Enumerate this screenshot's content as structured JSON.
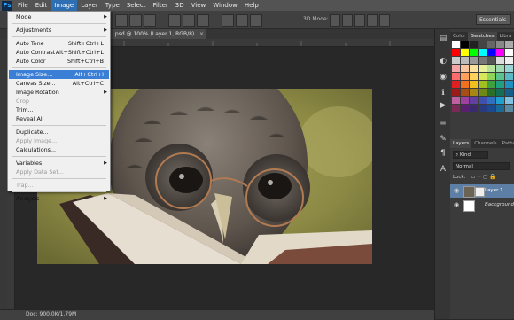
{
  "menubar": {
    "logo": "Ps",
    "items": [
      "File",
      "Edit",
      "Image",
      "Layer",
      "Type",
      "Select",
      "Filter",
      "3D",
      "View",
      "Window",
      "Help"
    ],
    "active_index": 2
  },
  "options_bar": {
    "mode_label": "3D Mode:",
    "workspace_label": "Essentials"
  },
  "document_tab": {
    "label": ".psd @ 100% (Layer 1, RGB/8)",
    "close": "×"
  },
  "status_bar": {
    "doc_info": "Doc: 900.0K/1.79M"
  },
  "image_menu": {
    "items": [
      {
        "label": "Mode",
        "shortcut": "",
        "submenu": true,
        "disabled": false
      },
      {
        "sep": true
      },
      {
        "label": "Adjustments",
        "shortcut": "",
        "submenu": true,
        "disabled": false
      },
      {
        "sep": true
      },
      {
        "label": "Auto Tone",
        "shortcut": "Shift+Ctrl+L",
        "disabled": false
      },
      {
        "label": "Auto Contrast",
        "shortcut": "Alt+Shift+Ctrl+L",
        "disabled": false
      },
      {
        "label": "Auto Color",
        "shortcut": "Shift+Ctrl+B",
        "disabled": false
      },
      {
        "sep": true
      },
      {
        "label": "Image Size...",
        "shortcut": "Alt+Ctrl+I",
        "disabled": false,
        "highlighted": true
      },
      {
        "label": "Canvas Size...",
        "shortcut": "Alt+Ctrl+C",
        "disabled": false
      },
      {
        "label": "Image Rotation",
        "shortcut": "",
        "submenu": true,
        "disabled": false
      },
      {
        "label": "Crop",
        "shortcut": "",
        "disabled": true
      },
      {
        "label": "Trim...",
        "shortcut": "",
        "disabled": false
      },
      {
        "label": "Reveal All",
        "shortcut": "",
        "disabled": false
      },
      {
        "sep": true
      },
      {
        "label": "Duplicate...",
        "shortcut": "",
        "disabled": false
      },
      {
        "label": "Apply Image...",
        "shortcut": "",
        "disabled": true
      },
      {
        "label": "Calculations...",
        "shortcut": "",
        "disabled": false
      },
      {
        "sep": true
      },
      {
        "label": "Variables",
        "shortcut": "",
        "submenu": true,
        "disabled": false
      },
      {
        "label": "Apply Data Set...",
        "shortcut": "",
        "disabled": true
      },
      {
        "sep": true
      },
      {
        "label": "Trap...",
        "shortcut": "",
        "disabled": true
      },
      {
        "sep": true
      },
      {
        "label": "Analysis",
        "shortcut": "",
        "submenu": true,
        "disabled": false
      }
    ]
  },
  "swatches_panel": {
    "tabs": [
      "Color",
      "Swatches",
      "Libra"
    ],
    "active_tab": 1,
    "colors": [
      "#ffffff",
      "#000000",
      "#222222",
      "#444444",
      "#666666",
      "#888888",
      "#aaaaaa",
      "#ff0000",
      "#ffff00",
      "#00ff00",
      "#00ffff",
      "#0000ff",
      "#ff00ff",
      "#ffffff",
      "#cccccc",
      "#bbbbbb",
      "#999999",
      "#777777",
      "#555555",
      "#dddddd",
      "#eeeeee",
      "#f4a6a6",
      "#f7c59f",
      "#fbe39f",
      "#e8f19a",
      "#b6e39c",
      "#9fd9b1",
      "#99d4d6",
      "#ff6b6b",
      "#ff9f5a",
      "#ffd25a",
      "#d8e85a",
      "#8fd45a",
      "#5ac48f",
      "#5ab8c4",
      "#e02020",
      "#f07020",
      "#f0c020",
      "#a0c020",
      "#40a040",
      "#20a080",
      "#2090c0",
      "#9b1b1b",
      "#a84d14",
      "#a88614",
      "#6e8a14",
      "#2a6e2a",
      "#146e55",
      "#145f8a",
      "#c060a0",
      "#a040a0",
      "#6040a0",
      "#4050b0",
      "#3070c0",
      "#20a0d0",
      "#80c0e0",
      "#7a2a55",
      "#5a2070",
      "#3a2a70",
      "#2a3a80",
      "#1a4a90",
      "#1a6a9a",
      "#5a8aa0"
    ]
  },
  "layers_panel": {
    "tabs": [
      "Layers",
      "Channels",
      "Paths"
    ],
    "active_tab": 0,
    "kind_filter": "Kind",
    "blend_mode": "Normal",
    "lock_label": "Lock:",
    "layers": [
      {
        "name": "Layer 1",
        "selected": true
      },
      {
        "name": "Background",
        "selected": false
      }
    ]
  },
  "colors": {
    "accent": "#3a7fd5",
    "menubar": "#535353",
    "panel": "#3b3b3b"
  }
}
